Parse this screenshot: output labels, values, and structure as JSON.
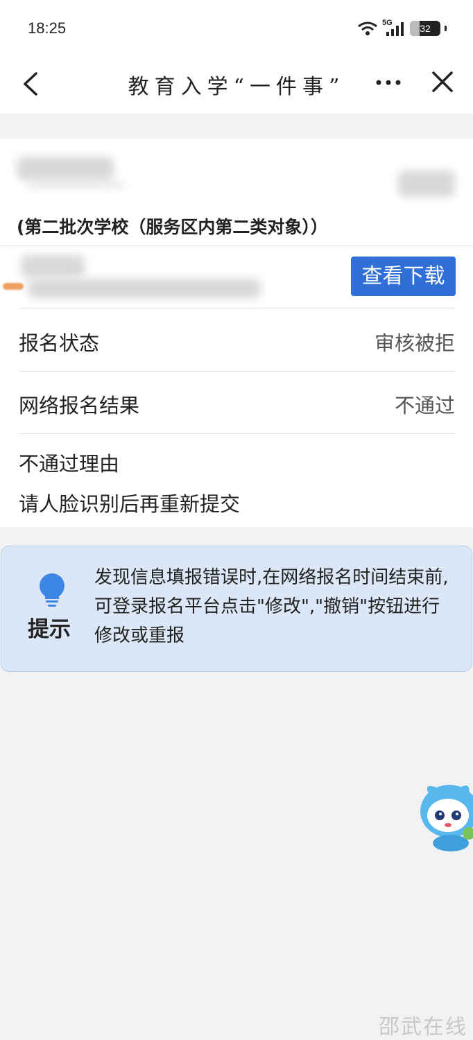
{
  "status_bar": {
    "time": "18:25",
    "network": "5G",
    "battery": "32"
  },
  "nav": {
    "title": "教育入学“一件事”"
  },
  "application": {
    "category": "(第二批次学校（服务区内第二类对象））",
    "view_download_label": "查看下载",
    "status_label": "报名状态",
    "status_value": "审核被拒",
    "result_label": "网络报名结果",
    "result_value": "不通过",
    "reason_label": "不通过理由",
    "reason_text": "请人脸识别后再重新提交"
  },
  "tip": {
    "label": "提示",
    "text": "发现信息填报错误时,在网络报名时间结束前,可登录报名平台点击\"修改\",\"撤销\"按钮进行修改或重报"
  },
  "watermark": "邵武在线",
  "colors": {
    "primary": "#2f6fd6",
    "tip_bg": "#dbe6f6",
    "tip_icon": "#3d86e8"
  }
}
